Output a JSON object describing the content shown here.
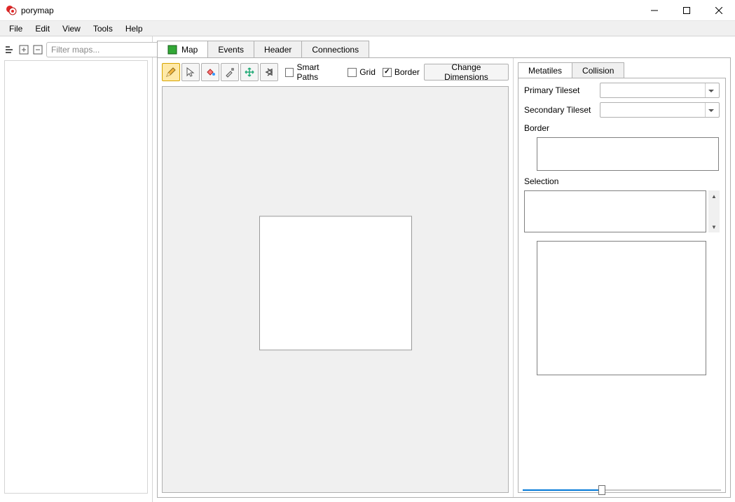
{
  "window": {
    "title": "porymap"
  },
  "menu": {
    "file": "File",
    "edit": "Edit",
    "view": "View",
    "tools": "Tools",
    "help": "Help"
  },
  "left": {
    "filter_placeholder": "Filter maps..."
  },
  "tabs": {
    "map": "Map",
    "events": "Events",
    "header": "Header",
    "connections": "Connections"
  },
  "toolbar": {
    "smart_paths": "Smart Paths",
    "grid": "Grid",
    "border": "Border",
    "change_dimensions": "Change Dimensions",
    "smart_paths_checked": false,
    "grid_checked": false,
    "border_checked": true
  },
  "right": {
    "tab_metatiles": "Metatiles",
    "tab_collision": "Collision",
    "primary_tileset_label": "Primary Tileset",
    "secondary_tileset_label": "Secondary Tileset",
    "primary_tileset_value": "",
    "secondary_tileset_value": "",
    "border_label": "Border",
    "selection_label": "Selection",
    "slider_value": 40
  }
}
